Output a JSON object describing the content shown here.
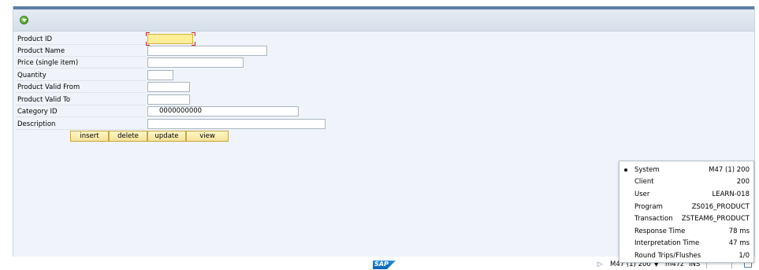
{
  "form": {
    "fields": [
      {
        "label": "Product ID",
        "value": ""
      },
      {
        "label": "Product Name",
        "value": ""
      },
      {
        "label": "Price (single item)",
        "value": ""
      },
      {
        "label": "Quantity",
        "value": ""
      },
      {
        "label": "Product Valid From",
        "value": ""
      },
      {
        "label": "Product Valid To",
        "value": ""
      },
      {
        "label": "Category ID",
        "value": "0000000000"
      },
      {
        "label": "Description",
        "value": ""
      }
    ],
    "buttons": {
      "insert": "insert",
      "delete": "delete",
      "update": "update",
      "view": "view"
    }
  },
  "footer": {
    "logo": "SAP",
    "status": {
      "system": "M47 (1) 200",
      "server": "m47z",
      "mode": "INS"
    }
  },
  "system_popup": {
    "items": [
      {
        "key": "System",
        "value": "M47 (1) 200"
      },
      {
        "key": "Client",
        "value": "200"
      },
      {
        "key": "User",
        "value": "LEARN-018"
      },
      {
        "key": "Program",
        "value": "ZS016_PRODUCT"
      },
      {
        "key": "Transaction",
        "value": "ZSTEAM6_PRODUCT"
      },
      {
        "key": "Response Time",
        "value": "78 ms"
      },
      {
        "key": "Interpretation Time",
        "value": "47 ms"
      },
      {
        "key": "Round Trips/Flushes",
        "value": "1/0"
      }
    ]
  },
  "colors": {
    "frame": "#f0f4fa",
    "focus_field": "#ffee99",
    "button": "#f5e39a",
    "topbar": "#5c7ea3"
  }
}
